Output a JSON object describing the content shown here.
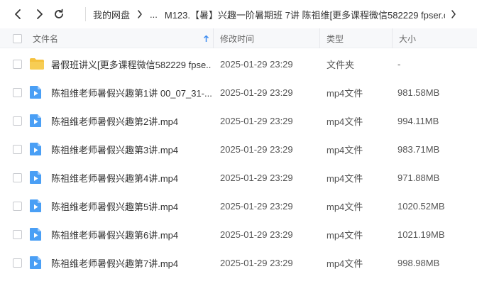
{
  "toolbar": {
    "back_icon": "chevron-left-icon",
    "forward_icon": "chevron-right-icon",
    "refresh_icon": "refresh-icon",
    "breadcrumb": {
      "root": "我的网盘",
      "ellipsis": "...",
      "current": "M123.【暑】兴趣一阶暑期班 7讲 陈祖维[更多课程微信582229 fpser.co..."
    }
  },
  "columns": {
    "name": "文件名",
    "modified": "修改时间",
    "type": "类型",
    "size": "大小",
    "sort_icon": "sort-ascending-arrow-icon"
  },
  "colors": {
    "folder": "#f5c13d",
    "video": "#4a9ff5",
    "sort_arrow": "#3d8cf0"
  },
  "files": [
    {
      "name": "暑假班讲义[更多课程微信582229 fpse...",
      "modified": "2025-01-29 23:29",
      "type": "文件夹",
      "size": "-",
      "kind": "folder"
    },
    {
      "name": "陈祖维老师暑假兴趣第1讲 00_07_31-...",
      "modified": "2025-01-29 23:29",
      "type": "mp4文件",
      "size": "981.58MB",
      "kind": "video"
    },
    {
      "name": "陈祖维老师暑假兴趣第2讲.mp4",
      "modified": "2025-01-29 23:29",
      "type": "mp4文件",
      "size": "994.11MB",
      "kind": "video"
    },
    {
      "name": "陈祖维老师暑假兴趣第3讲.mp4",
      "modified": "2025-01-29 23:29",
      "type": "mp4文件",
      "size": "983.71MB",
      "kind": "video"
    },
    {
      "name": "陈祖维老师暑假兴趣第4讲.mp4",
      "modified": "2025-01-29 23:29",
      "type": "mp4文件",
      "size": "971.88MB",
      "kind": "video"
    },
    {
      "name": "陈祖维老师暑假兴趣第5讲.mp4",
      "modified": "2025-01-29 23:29",
      "type": "mp4文件",
      "size": "1020.52MB",
      "kind": "video"
    },
    {
      "name": "陈祖维老师暑假兴趣第6讲.mp4",
      "modified": "2025-01-29 23:29",
      "type": "mp4文件",
      "size": "1021.19MB",
      "kind": "video"
    },
    {
      "name": "陈祖维老师暑假兴趣第7讲.mp4",
      "modified": "2025-01-29 23:29",
      "type": "mp4文件",
      "size": "998.98MB",
      "kind": "video"
    }
  ]
}
